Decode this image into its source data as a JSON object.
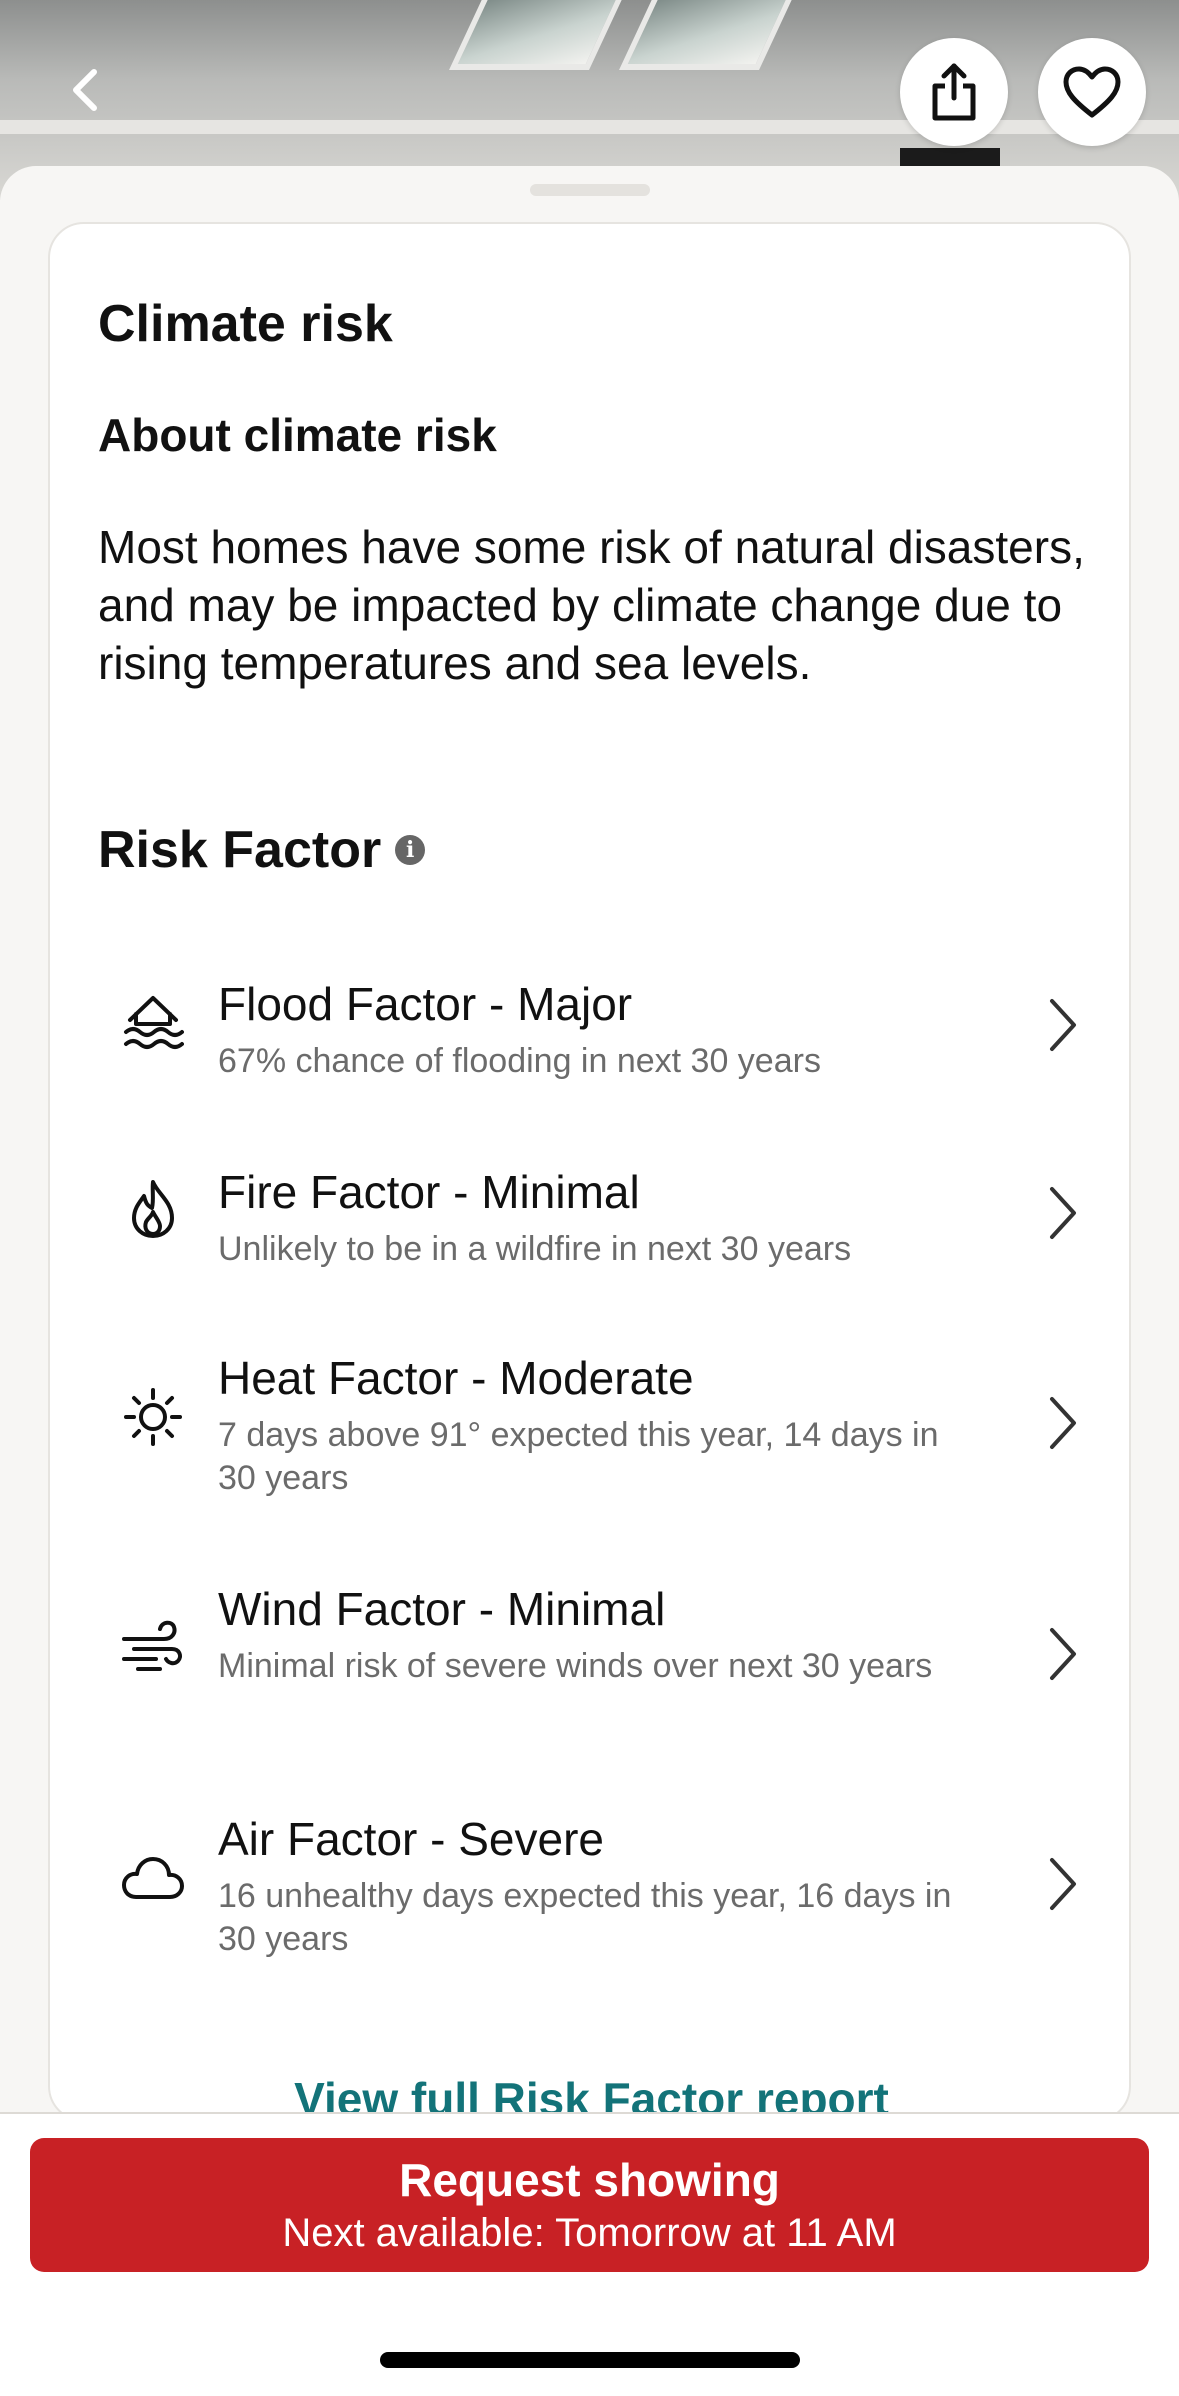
{
  "colors": {
    "accent_link": "#137379",
    "cta_background": "#c82125",
    "text_primary": "#111111",
    "text_secondary": "#6b6b6b"
  },
  "header": {
    "back_icon": "chevron-left-icon",
    "share_icon": "share-icon",
    "favorite_icon": "heart-icon"
  },
  "climate": {
    "title": "Climate risk",
    "about_title": "About climate risk",
    "about_body": "Most homes have some risk of natural disasters, and may be impacted by climate change due to rising temperatures and sea levels."
  },
  "risk_factor": {
    "title": "Risk Factor",
    "info_icon": "info-icon",
    "items": [
      {
        "icon": "flood-icon",
        "title": "Flood Factor - Major",
        "subtitle": "67% chance of flooding in next 30 years"
      },
      {
        "icon": "fire-icon",
        "title": "Fire Factor - Minimal",
        "subtitle": "Unlikely to be in a wildfire in next 30 years"
      },
      {
        "icon": "sun-icon",
        "title": "Heat Factor - Moderate",
        "subtitle": "7 days above 91° expected this year, 14 days in 30 years"
      },
      {
        "icon": "wind-icon",
        "title": "Wind Factor - Minimal",
        "subtitle": "Minimal risk of severe winds over next 30 years"
      },
      {
        "icon": "cloud-icon",
        "title": "Air Factor - Severe",
        "subtitle": "16 unhealthy days expected this year, 16 days in 30 years"
      }
    ],
    "report_link": "View full Risk Factor report"
  },
  "cta": {
    "label": "Request showing",
    "sublabel": "Next available: Tomorrow at 11 AM"
  }
}
